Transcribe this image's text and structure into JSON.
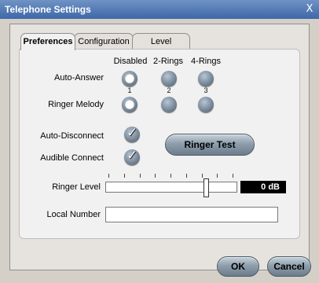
{
  "window": {
    "title": "Telephone Settings",
    "close": "X"
  },
  "tabs": [
    {
      "label": "Preferences",
      "active": true
    },
    {
      "label": "Configuration",
      "active": false
    },
    {
      "label": "Level",
      "active": false
    }
  ],
  "answer_options": {
    "headers": [
      "Disabled",
      "2-Rings",
      "4-Rings"
    ],
    "selected": "Disabled"
  },
  "auto_answer": {
    "label": "Auto-Answer"
  },
  "ringer_melody": {
    "label": "Ringer Melody",
    "options": [
      "1",
      "2",
      "3"
    ],
    "selected": "1"
  },
  "auto_disconnect": {
    "label": "Auto-Disconnect",
    "checked": true
  },
  "audible_connect": {
    "label": "Audible Connect",
    "checked": true
  },
  "ringer_test": {
    "label": "Ringer Test"
  },
  "ringer_level": {
    "label": "Ringer Level",
    "display": "0 dB",
    "position_fraction": 0.77
  },
  "local_number": {
    "label": "Local Number",
    "value": ""
  },
  "buttons": {
    "ok": "OK",
    "cancel": "Cancel"
  }
}
